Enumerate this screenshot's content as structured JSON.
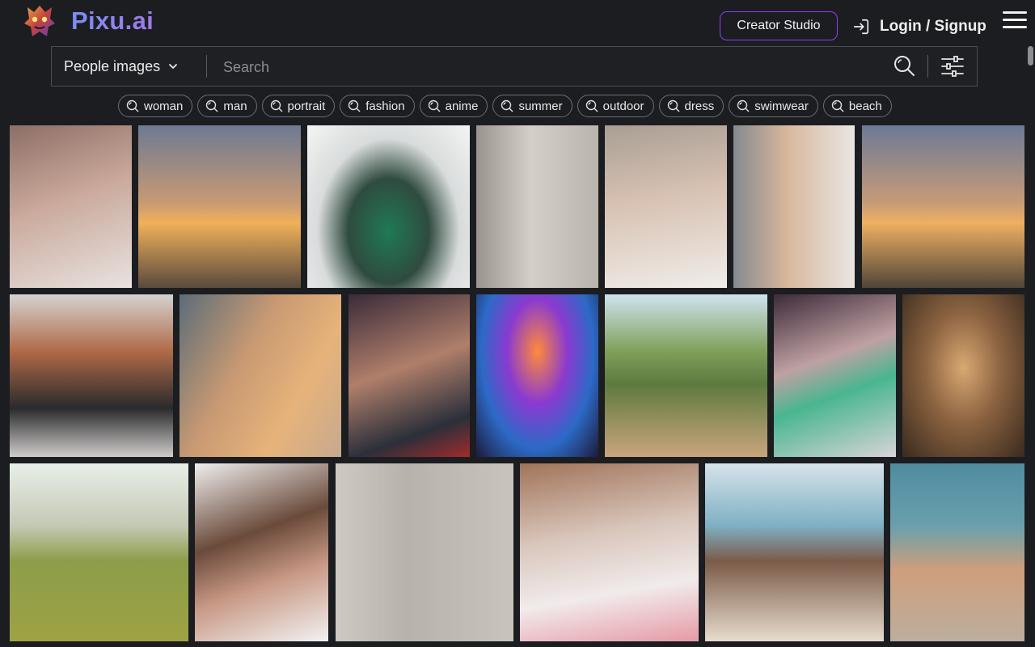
{
  "brand": {
    "name": "Pixu.ai"
  },
  "header": {
    "creator_studio": "Creator Studio",
    "login": "Login / Signup"
  },
  "search": {
    "category": "People images",
    "placeholder": "Search"
  },
  "tags": [
    "woman",
    "man",
    "portrait",
    "fashion",
    "anime",
    "summer",
    "outdoor",
    "dress",
    "swimwear",
    "beach"
  ],
  "colors": {
    "background": "#1b1d21",
    "accent_border": "#8a3ff2",
    "brand_gradient_start": "#7b8df6",
    "brand_gradient_end": "#a07ae8"
  },
  "icons": [
    "logo-mask-icon",
    "login-icon",
    "menu-icon",
    "chevron-down-icon",
    "search-icon",
    "filter-sliders-icon",
    "tag-search-icon"
  ]
}
